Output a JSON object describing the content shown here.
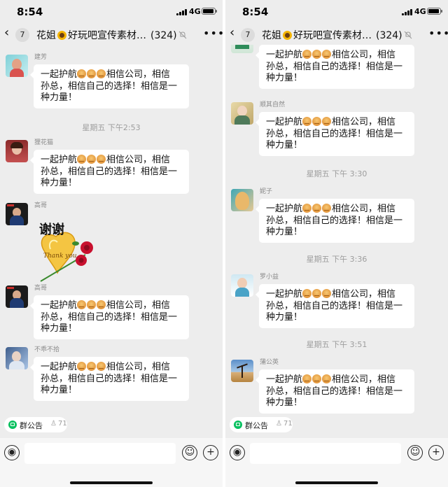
{
  "panels": [
    {
      "status": {
        "time": "8:54",
        "network": "4G"
      },
      "nav": {
        "back_icon": "chevron-left-icon",
        "unread": "7",
        "name": "花姐",
        "group": "好玩吧宣传素材…",
        "count": "(324)"
      },
      "messages": [
        {
          "sender": "建芳",
          "line1_pre": "一起护航",
          "line1_post": "相信公司，相信",
          "line2": "孙总，相信自己的选择！相信是一",
          "line3": "种力量！"
        },
        {
          "sender": "狸花猫",
          "line1_pre": "一起护航",
          "line1_post": "相信公司，相信",
          "line2": "孙总，相信自己的选择！相信是一",
          "line3": "种力量！"
        },
        {
          "sender": "高哥",
          "line1_pre": "一起护航",
          "line1_post": "相信公司，相信",
          "line2": "孙总，相信自己的选择！相信是一",
          "line3": "种力量！"
        },
        {
          "sender": "不乖不拾",
          "line1_pre": "一起护航",
          "line1_post": "相信公司，相信",
          "line2": "孙总，相信自己的选择！相信是一",
          "line3": "种力量！"
        }
      ],
      "timestamps": [
        "星期五 下午2:53"
      ],
      "sticker": {
        "sender": "高哥",
        "text_main": "谢谢",
        "text_sub": "Thank you"
      },
      "notice": {
        "label": "群公告",
        "members": "71"
      }
    },
    {
      "status": {
        "time": "8:54",
        "network": "4G"
      },
      "nav": {
        "back_icon": "chevron-left-icon",
        "unread": "7",
        "name": "花姐",
        "group": "好玩吧宣传素材…",
        "count": "(324)"
      },
      "messages": [
        {
          "sender": "",
          "line1_pre": "一起护航",
          "line1_post": "相信公司，相信",
          "line2": "孙总，相信自己的选择！相信是一",
          "line3": "种力量！"
        },
        {
          "sender": "顺其自然",
          "line1_pre": "一起护航",
          "line1_post": "相信公司，相信",
          "line2": "孙总，相信自己的选择！相信是一",
          "line3": "种力量！"
        },
        {
          "sender": "妮子",
          "line1_pre": "一起护航",
          "line1_post": "相信公司，相信",
          "line2": "孙总，相信自己的选择！相信是一",
          "line3": "种力量！"
        },
        {
          "sender": "罗小益",
          "line1_pre": "一起护航",
          "line1_post": "相信公司，相信",
          "line2": "孙总，相信自己的选择！相信是一",
          "line3": "种力量！"
        },
        {
          "sender": "蒲公英",
          "line1_pre": "一起护航",
          "line1_post": "相信公司，相信",
          "line2": "孙总，相信自己的选择！相信是一",
          "line3": "种力量！"
        }
      ],
      "timestamps": [
        "星期五 下午 3:30",
        "星期五 下午 3:36",
        "星期五 下午 3:51"
      ],
      "notice": {
        "label": "群公告",
        "members": "71"
      }
    }
  ],
  "colors": {
    "background": "#ededed",
    "bubble": "#ffffff",
    "accent_green": "#07c160",
    "timestamp": "#9d9d9d"
  },
  "icons": {
    "emoji_in_text": "fist-emoji-icon",
    "title_emoji": "sunflower-icon",
    "mute": "bell-slash-icon",
    "more": "ellipsis-icon",
    "voice": "voice-icon",
    "emoji_button": "smiley-icon",
    "add": "plus-icon",
    "notice": "announcement-icon",
    "members": "person-icon"
  }
}
